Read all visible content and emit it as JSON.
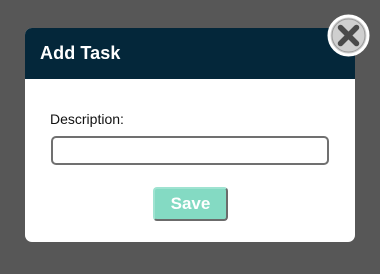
{
  "dialog": {
    "title": "Add Task",
    "description_label": "Description:",
    "description_value": "",
    "description_placeholder": "",
    "save_label": "Save",
    "close_icon": "close-icon"
  },
  "colors": {
    "overlay": "#575757",
    "header": "#04273a",
    "save_button": "#84dac3",
    "close_button": "#cfcfcf"
  }
}
